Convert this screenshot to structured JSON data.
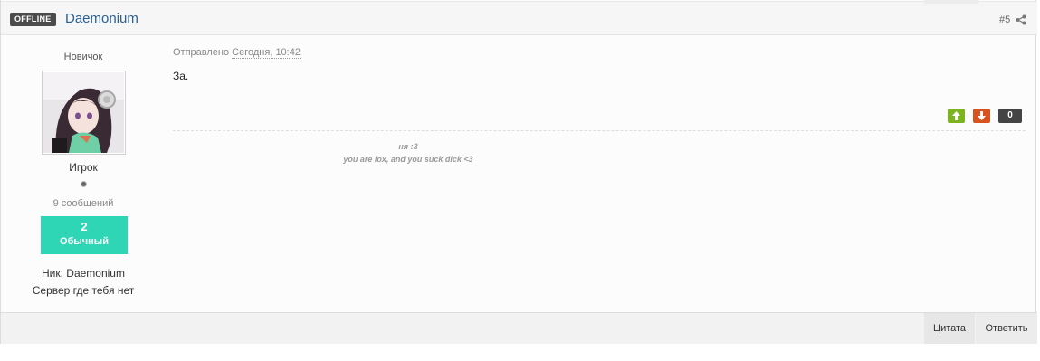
{
  "header": {
    "status_badge": "OFFLINE",
    "author_name": "Daemonium",
    "post_number": "#5"
  },
  "author": {
    "rank": "Новичок",
    "group": "Игрок",
    "posts_count": "9 сообщений",
    "reputation_value": "2",
    "reputation_label": "Обычный",
    "custom_fields": [
      "Ник: Daemonium",
      "Сервер где тебя нет"
    ]
  },
  "post": {
    "meta_prefix": "Отправлено",
    "date": "Сегодня, 10:42",
    "body": "За.",
    "vote_count": "0",
    "signature": [
      "ня :3",
      "you are lox, and you suck dick <3"
    ]
  },
  "footer": {
    "quote_label": "Цитата",
    "reply_label": "Ответить"
  },
  "colors": {
    "accent_link": "#2a5f8f",
    "reputation": "#2fd6b5",
    "vote_up": "#7cb320",
    "vote_down": "#d9531e",
    "badge": "#4b4b4b"
  },
  "icons": [
    "share-icon",
    "arrow-up-icon",
    "arrow-down-icon",
    "online-indicator-icon"
  ]
}
